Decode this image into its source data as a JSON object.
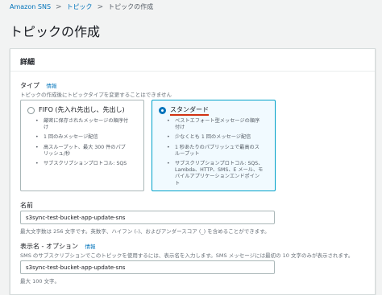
{
  "breadcrumb": {
    "items": [
      "Amazon SNS",
      "トピック",
      "トピックの作成"
    ],
    "separator": ">"
  },
  "page_title": "トピックの作成",
  "panel": {
    "title": "詳細"
  },
  "type_section": {
    "label": "タイプ",
    "info": "情報",
    "description": "トピックの作成後にトピックタイプを変更することはできません",
    "options": [
      {
        "title": "FIFO (先入れ先出し、先出し)",
        "selected": false,
        "bullets": [
          "厳密に保存されたメッセージの順序付け",
          "1 回のみメッセージ配信",
          "高スループット、最大 300 件のパブリッシュ/秒",
          "サブスクリプションプロトコル: SQS"
        ]
      },
      {
        "title": "スタンダード",
        "selected": true,
        "bullets": [
          "ベストエフォート型メッセージの順序付け",
          "少なくとも 1 回のメッセージ配信",
          "1 秒あたりのパブリッシュで最高のスループット",
          "サブスクリプションプロトコル: SQS、Lambda、HTTP、SMS、E メール、モバイルアプリケーションエンドポイント"
        ]
      }
    ]
  },
  "name_field": {
    "label": "名前",
    "value": "s3sync-test-bucket-app-update-sns",
    "hint": "最大文字数は 256 文字です。英数字、ハイフン (-)、およびアンダースコア (_) を含めることができます。"
  },
  "display_name_field": {
    "label": "表示名 - オプション",
    "info": "情報",
    "description": "SMS のサブスクリプションでこのトピックを使用するには、表示名を入力します。SMS メッセージには最初の 10 文字のみが表示されます。",
    "value": "s3sync-test-bucket-app-update-sns",
    "hint": "最大 100 文字。"
  },
  "colors": {
    "link": "#0073bb",
    "selected_border": "#00a1c9",
    "annotation_underline": "#d13212"
  }
}
